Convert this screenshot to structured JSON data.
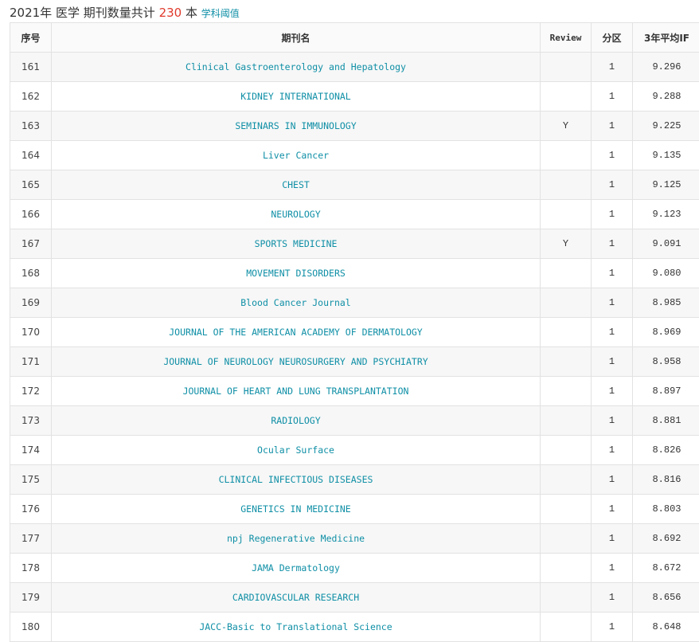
{
  "header": {
    "year": "2021年",
    "subject": "医学",
    "count_label": "期刊数量共计",
    "count": "230",
    "unit": "本",
    "link": "学科阈值"
  },
  "table": {
    "columns": [
      "序号",
      "期刊名",
      "Review",
      "分区",
      "3年平均IF"
    ],
    "rows": [
      {
        "idx": "161",
        "name": "Clinical Gastroenterology and Hepatology",
        "review": "",
        "zone": "1",
        "if": "9.296"
      },
      {
        "idx": "162",
        "name": "KIDNEY INTERNATIONAL",
        "review": "",
        "zone": "1",
        "if": "9.288"
      },
      {
        "idx": "163",
        "name": "SEMINARS IN IMMUNOLOGY",
        "review": "Y",
        "zone": "1",
        "if": "9.225"
      },
      {
        "idx": "164",
        "name": "Liver Cancer",
        "review": "",
        "zone": "1",
        "if": "9.135"
      },
      {
        "idx": "165",
        "name": "CHEST",
        "review": "",
        "zone": "1",
        "if": "9.125"
      },
      {
        "idx": "166",
        "name": "NEUROLOGY",
        "review": "",
        "zone": "1",
        "if": "9.123"
      },
      {
        "idx": "167",
        "name": "SPORTS MEDICINE",
        "review": "Y",
        "zone": "1",
        "if": "9.091"
      },
      {
        "idx": "168",
        "name": "MOVEMENT DISORDERS",
        "review": "",
        "zone": "1",
        "if": "9.080"
      },
      {
        "idx": "169",
        "name": "Blood Cancer Journal",
        "review": "",
        "zone": "1",
        "if": "8.985"
      },
      {
        "idx": "170",
        "name": "JOURNAL OF THE AMERICAN ACADEMY OF DERMATOLOGY",
        "review": "",
        "zone": "1",
        "if": "8.969"
      },
      {
        "idx": "171",
        "name": "JOURNAL OF NEUROLOGY NEUROSURGERY AND PSYCHIATRY",
        "review": "",
        "zone": "1",
        "if": "8.958"
      },
      {
        "idx": "172",
        "name": "JOURNAL OF HEART AND LUNG TRANSPLANTATION",
        "review": "",
        "zone": "1",
        "if": "8.897"
      },
      {
        "idx": "173",
        "name": "RADIOLOGY",
        "review": "",
        "zone": "1",
        "if": "8.881"
      },
      {
        "idx": "174",
        "name": "Ocular Surface",
        "review": "",
        "zone": "1",
        "if": "8.826"
      },
      {
        "idx": "175",
        "name": "CLINICAL INFECTIOUS DISEASES",
        "review": "",
        "zone": "1",
        "if": "8.816"
      },
      {
        "idx": "176",
        "name": "GENETICS IN MEDICINE",
        "review": "",
        "zone": "1",
        "if": "8.803"
      },
      {
        "idx": "177",
        "name": "npj Regenerative Medicine",
        "review": "",
        "zone": "1",
        "if": "8.692"
      },
      {
        "idx": "178",
        "name": "JAMA Dermatology",
        "review": "",
        "zone": "1",
        "if": "8.672"
      },
      {
        "idx": "179",
        "name": "CARDIOVASCULAR RESEARCH",
        "review": "",
        "zone": "1",
        "if": "8.656"
      },
      {
        "idx": "180",
        "name": "JACC-Basic to Translational Science",
        "review": "",
        "zone": "1",
        "if": "8.648"
      }
    ]
  },
  "colors": {
    "link": "#0f8fa6",
    "count": "#e0392b",
    "border": "#e2e2e2"
  }
}
